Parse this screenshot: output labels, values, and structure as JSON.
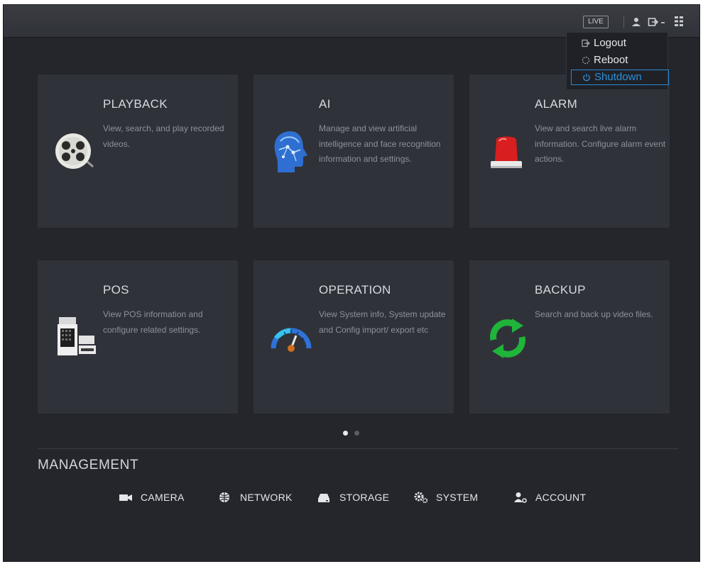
{
  "topbar": {
    "live_label": "LIVE"
  },
  "account_menu": {
    "items": [
      {
        "label": "Logout",
        "icon": "logout-icon"
      },
      {
        "label": "Reboot",
        "icon": "reboot-icon"
      },
      {
        "label": "Shutdown",
        "icon": "power-icon",
        "selected": true
      }
    ]
  },
  "cards": [
    {
      "title": "PLAYBACK",
      "desc": "View, search, and play recorded videos.",
      "icon": "film-reel-icon"
    },
    {
      "title": "AI",
      "desc": "Manage and view artificial intelligence and face recognition information and settings.",
      "icon": "ai-head-icon"
    },
    {
      "title": "ALARM",
      "desc": "View and search live alarm information. Configure alarm event actions.",
      "icon": "alarm-siren-icon"
    },
    {
      "title": "POS",
      "desc": "View POS information and configure related settings.",
      "icon": "pos-terminal-icon"
    },
    {
      "title": "OPERATION",
      "desc": "View System info, System update and Config import/ export etc",
      "icon": "gauge-icon"
    },
    {
      "title": "BACKUP",
      "desc": "Search and back up video files.",
      "icon": "refresh-arrows-icon"
    }
  ],
  "pagination": {
    "current": 1,
    "total": 2
  },
  "management": {
    "title": "MANAGEMENT",
    "items": [
      {
        "label": "CAMERA",
        "icon": "camera-icon"
      },
      {
        "label": "NETWORK",
        "icon": "network-icon"
      },
      {
        "label": "STORAGE",
        "icon": "storage-icon"
      },
      {
        "label": "SYSTEM",
        "icon": "gears-icon"
      },
      {
        "label": "ACCOUNT",
        "icon": "account-icon"
      }
    ]
  },
  "colors": {
    "background": "#24262b",
    "card": "#30323a",
    "accent": "#2b8ad6"
  }
}
